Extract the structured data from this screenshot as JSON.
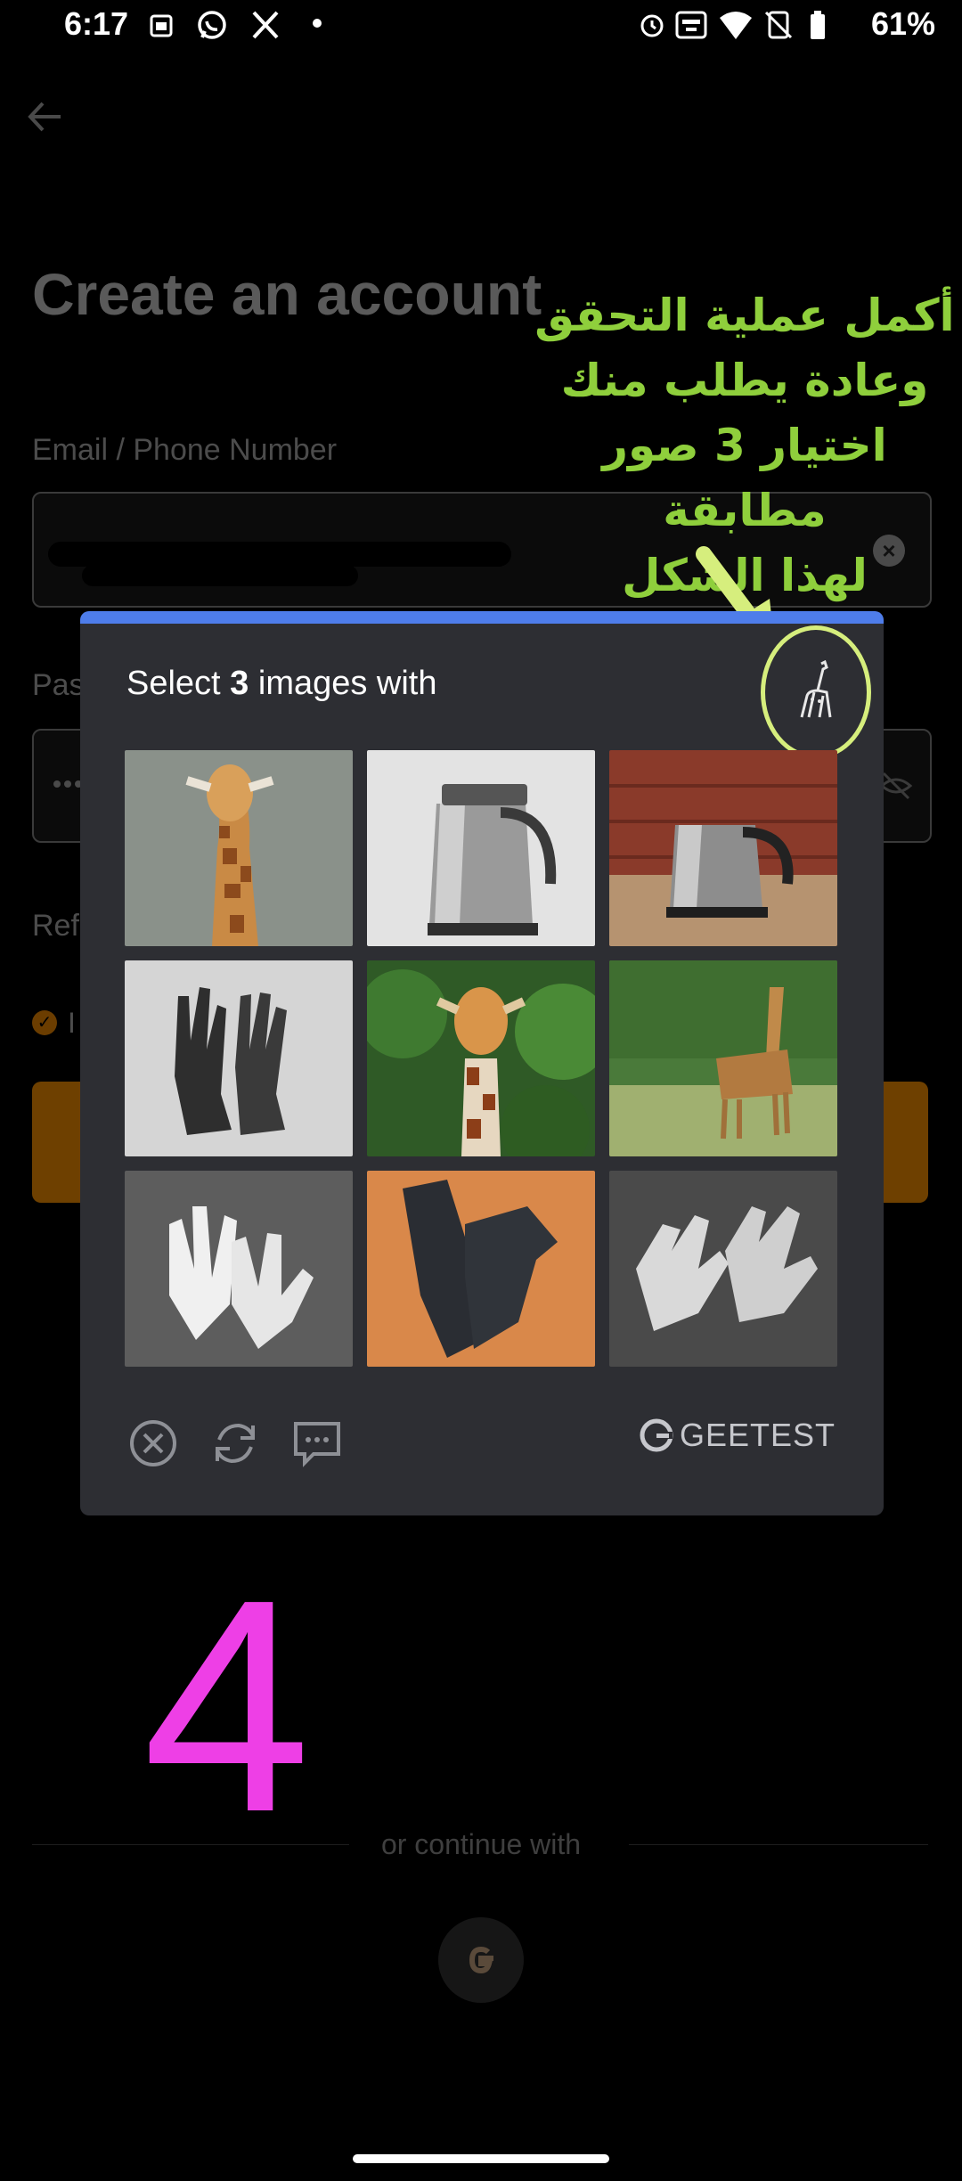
{
  "status_bar": {
    "time": "6:17",
    "battery_percent": "61%",
    "icons": [
      "sim-icon",
      "whatsapp-icon",
      "x-icon",
      "dot-icon",
      "alarm-icon",
      "auto-hz-icon",
      "wifi-icon",
      "no-signal-icon",
      "battery-icon"
    ]
  },
  "background_page": {
    "title": "Create an account",
    "email_label": "Email / Phone Number",
    "password_label_partial": "Pas",
    "referral_partial": "Ref",
    "agree_partial": "I",
    "or_continue": "or continue with"
  },
  "annotation": {
    "arabic_note_line1": "أكمل عملية التحقق",
    "arabic_note_line2": "وعادة يطلب منك",
    "arabic_note_line3": "اختيار 3 صور مطابقة",
    "arabic_note_line4": "لهذا الشكل",
    "step_number": "4",
    "colors": {
      "note": "#8fcf3c",
      "step": "#ee3fe6",
      "highlight": "#d6ee7d"
    }
  },
  "captcha": {
    "prompt_prefix": "Select ",
    "prompt_count": "3",
    "prompt_suffix": " images with",
    "sample_icon": "giraffe-icon",
    "tiles": [
      {
        "name": "tile-giraffe-1",
        "subject": "giraffe"
      },
      {
        "name": "tile-kettle-1",
        "subject": "kettle"
      },
      {
        "name": "tile-kettle-2",
        "subject": "kettle"
      },
      {
        "name": "tile-gloves-1",
        "subject": "gloves"
      },
      {
        "name": "tile-giraffe-2",
        "subject": "giraffe"
      },
      {
        "name": "tile-giraffe-3",
        "subject": "giraffe"
      },
      {
        "name": "tile-gloves-2",
        "subject": "gloves"
      },
      {
        "name": "tile-gloves-3",
        "subject": "gloves"
      },
      {
        "name": "tile-gloves-4",
        "subject": "gloves"
      }
    ],
    "footer_icons": [
      "close-icon",
      "refresh-icon",
      "feedback-icon"
    ],
    "brand": "GEETEST",
    "accent_color": "#4e7dea"
  }
}
